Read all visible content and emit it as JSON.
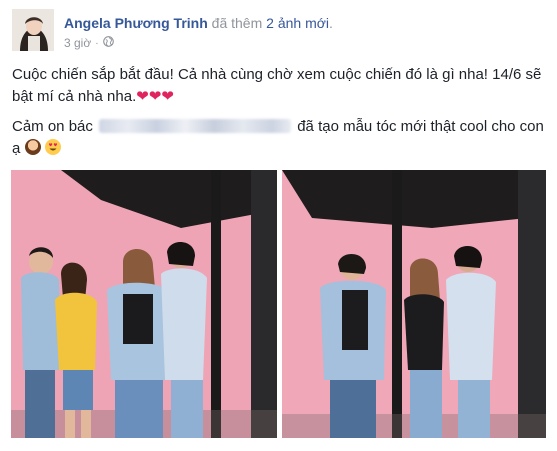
{
  "post": {
    "author": "Angela Phương Trinh",
    "action_prefix": "đã thêm",
    "action_highlight": "2 ảnh mới",
    "action_suffix": ".",
    "time": "3 giờ",
    "separator": "·",
    "privacy_icon": "globe-icon",
    "paragraph1": "Cuộc chiến sắp bắt đầu! Cả nhà cùng chờ xem cuộc chiến đó là gì nha! 14/6 sẽ bật mí cả nhà nha.",
    "hearts": "❤❤❤",
    "paragraph2_prefix": "Cảm on bác",
    "paragraph2_suffix": "đã tạo mẫu tóc mới thật cool cho con ạ"
  },
  "colors": {
    "link": "#365899",
    "meta": "#90949c",
    "backdrop": "#f0a7b8",
    "heart": "#e0245e"
  },
  "photos": [
    {
      "id": "photo-1"
    },
    {
      "id": "photo-2"
    }
  ]
}
